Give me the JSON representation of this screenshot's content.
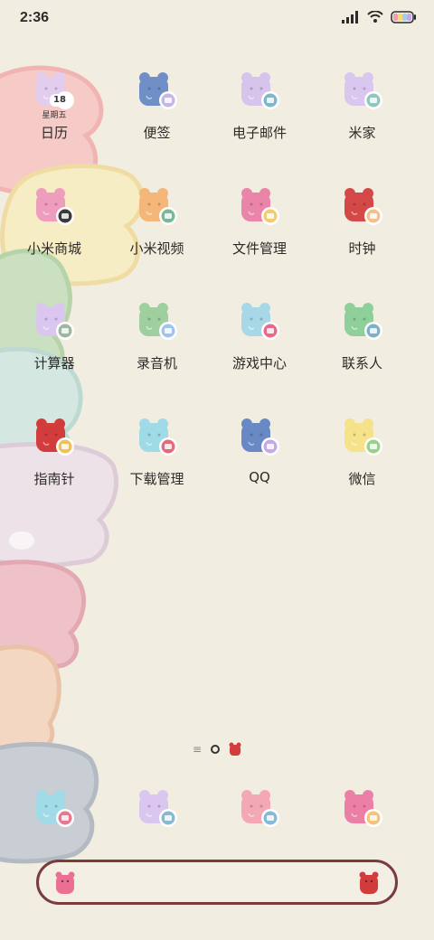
{
  "status_bar": {
    "time": "2:36"
  },
  "apps": [
    {
      "label": "日历",
      "icon": "calendar-icon",
      "bear_color": "#e2cdef",
      "badge_color": "#ffffff",
      "date_number": "18",
      "weekday": "星期五"
    },
    {
      "label": "便签",
      "icon": "notes-icon",
      "bear_color": "#6f8fc6",
      "badge_color": "#c6b6e4"
    },
    {
      "label": "电子邮件",
      "icon": "email-icon",
      "bear_color": "#d6c4ec",
      "badge_color": "#7fb6c9"
    },
    {
      "label": "米家",
      "icon": "mijia-icon",
      "bear_color": "#d9c7ef",
      "badge_color": "#8fc7be"
    },
    {
      "label": "小米商城",
      "icon": "mi-store-icon",
      "bear_color": "#ef9dbd",
      "badge_color": "#3a3a3a"
    },
    {
      "label": "小米视频",
      "icon": "video-icon",
      "bear_color": "#f5b679",
      "badge_color": "#7ab89a"
    },
    {
      "label": "文件管理",
      "icon": "folder-icon",
      "bear_color": "#ea84a8",
      "badge_color": "#f3cc6f"
    },
    {
      "label": "时钟",
      "icon": "clock-icon",
      "bear_color": "#d44848",
      "badge_color": "#f4c08e"
    },
    {
      "label": "计算器",
      "icon": "calculator-icon",
      "bear_color": "#dac6ef",
      "badge_color": "#9db7a0"
    },
    {
      "label": "录音机",
      "icon": "microphone-icon",
      "bear_color": "#9fcf9f",
      "badge_color": "#9fc5ec"
    },
    {
      "label": "游戏中心",
      "icon": "game-center-icon",
      "bear_color": "#a8d8e8",
      "badge_color": "#e86a88"
    },
    {
      "label": "联系人",
      "icon": "contacts-icon",
      "bear_color": "#8fcf9a",
      "badge_color": "#7db1c6"
    },
    {
      "label": "指南针",
      "icon": "compass-icon",
      "bear_color": "#d23c3c",
      "badge_color": "#f0c25e"
    },
    {
      "label": "下载管理",
      "icon": "download-icon",
      "bear_color": "#9fdbe6",
      "badge_color": "#e26c7c"
    },
    {
      "label": "QQ",
      "icon": "qq-icon",
      "bear_color": "#6889c4",
      "badge_color": "#c3aae6"
    },
    {
      "label": "微信",
      "icon": "wechat-icon",
      "bear_color": "#f5e28a",
      "badge_color": "#98d08c"
    }
  ],
  "dock": [
    {
      "icon": "phone-icon",
      "bear_color": "#a2dbe8",
      "badge_color": "#e67890"
    },
    {
      "icon": "gallery-icon",
      "bear_color": "#dac6ef",
      "badge_color": "#8ab8d0"
    },
    {
      "icon": "camera-icon",
      "bear_color": "#f4a7b5",
      "badge_color": "#86b8d8"
    },
    {
      "icon": "messages-icon",
      "bear_color": "#ec7fa6",
      "badge_color": "#f5c47a"
    }
  ],
  "page_indicator": {
    "pages": 2,
    "current": 1
  },
  "search_bar": {
    "left_bear_color": "#ea6f93",
    "right_bear_color": "#d23c3c"
  }
}
